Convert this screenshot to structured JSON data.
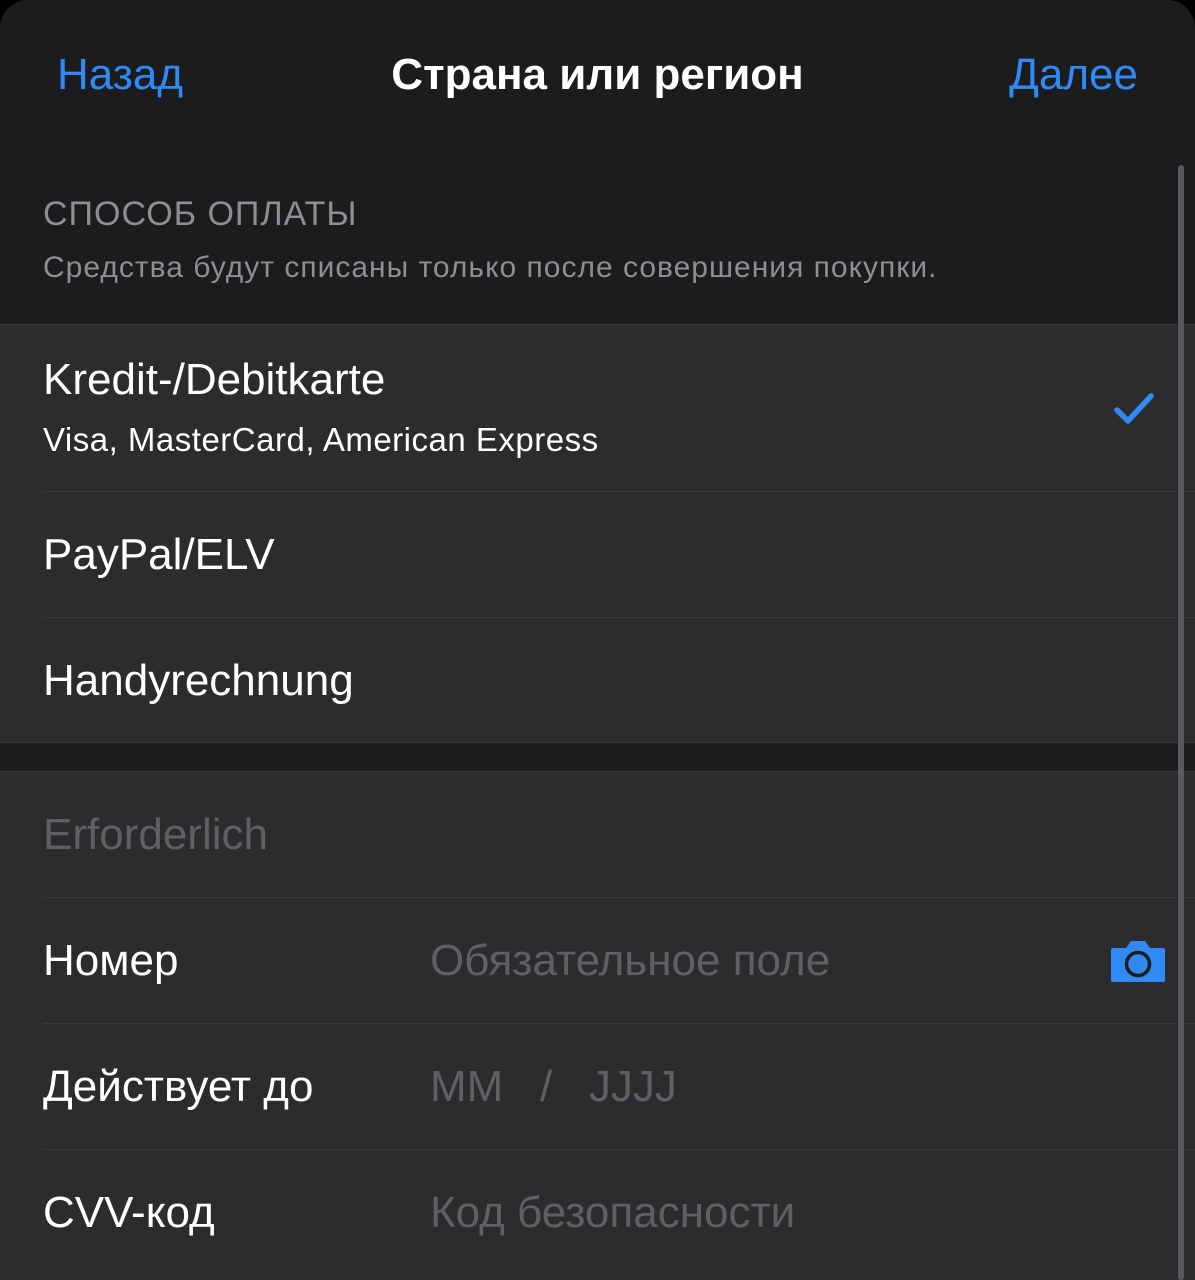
{
  "nav": {
    "back_label": "Назад",
    "title": "Страна или регион",
    "next_label": "Далее"
  },
  "payment_section": {
    "title": "СПОСОБ ОПЛАТЫ",
    "subtitle": "Средства будут списаны только после совершения покупки."
  },
  "payment_options": [
    {
      "title": "Kredit-/Debitkarte",
      "subtitle": "Visa, MasterCard, American Express",
      "selected": true
    },
    {
      "title": "PayPal/ELV",
      "selected": false
    },
    {
      "title": "Handyrechnung",
      "selected": false
    }
  ],
  "card_form": {
    "name_placeholder": "Erforderlich",
    "number_label": "Номер",
    "number_placeholder": "Обязательное поле",
    "expiry_label": "Действует до",
    "expiry_placeholder": "MM   /   JJJJ",
    "cvv_label": "CVV-код",
    "cvv_placeholder": "Код безопасности"
  },
  "icons": {
    "checkmark": "checkmark-icon",
    "camera": "camera-icon"
  },
  "colors": {
    "accent": "#2f8bf3",
    "background": "#1c1c1e",
    "cell": "#2c2c2e",
    "secondary_text": "#8e8e93",
    "placeholder_text": "#5f5f64"
  }
}
